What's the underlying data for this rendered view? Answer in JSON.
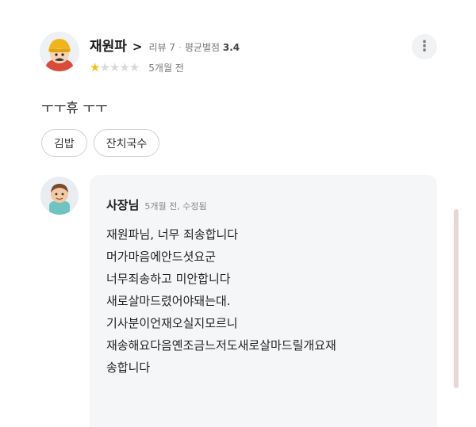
{
  "review": {
    "author": {
      "name": "재원파",
      "chevron": ">",
      "review_count_label": "리뷰 7",
      "average_label": "평균별점",
      "average_value": "3.4"
    },
    "rating": {
      "value": 1,
      "max": 5,
      "star_color": "#f5c10b"
    },
    "date": "5개월 전",
    "text": "ㅜㅜ휴 ㅜㅜ",
    "more_icon": "⋮",
    "tags": [
      "김밥",
      "잔치국수"
    ]
  },
  "reply": {
    "name": "사장님",
    "meta": "5개월 전, 수정됨",
    "lines": [
      "재원파님, 너무 죄송합니다",
      "머가마음에안드셧요군",
      "너무죄송하고 미안합니다",
      "새로살마드렸어야돼는대.",
      "기사분이언재오실지모르니",
      "재송해요다음옌조금느저도새로살마드릴개요재",
      "송합니다"
    ]
  }
}
